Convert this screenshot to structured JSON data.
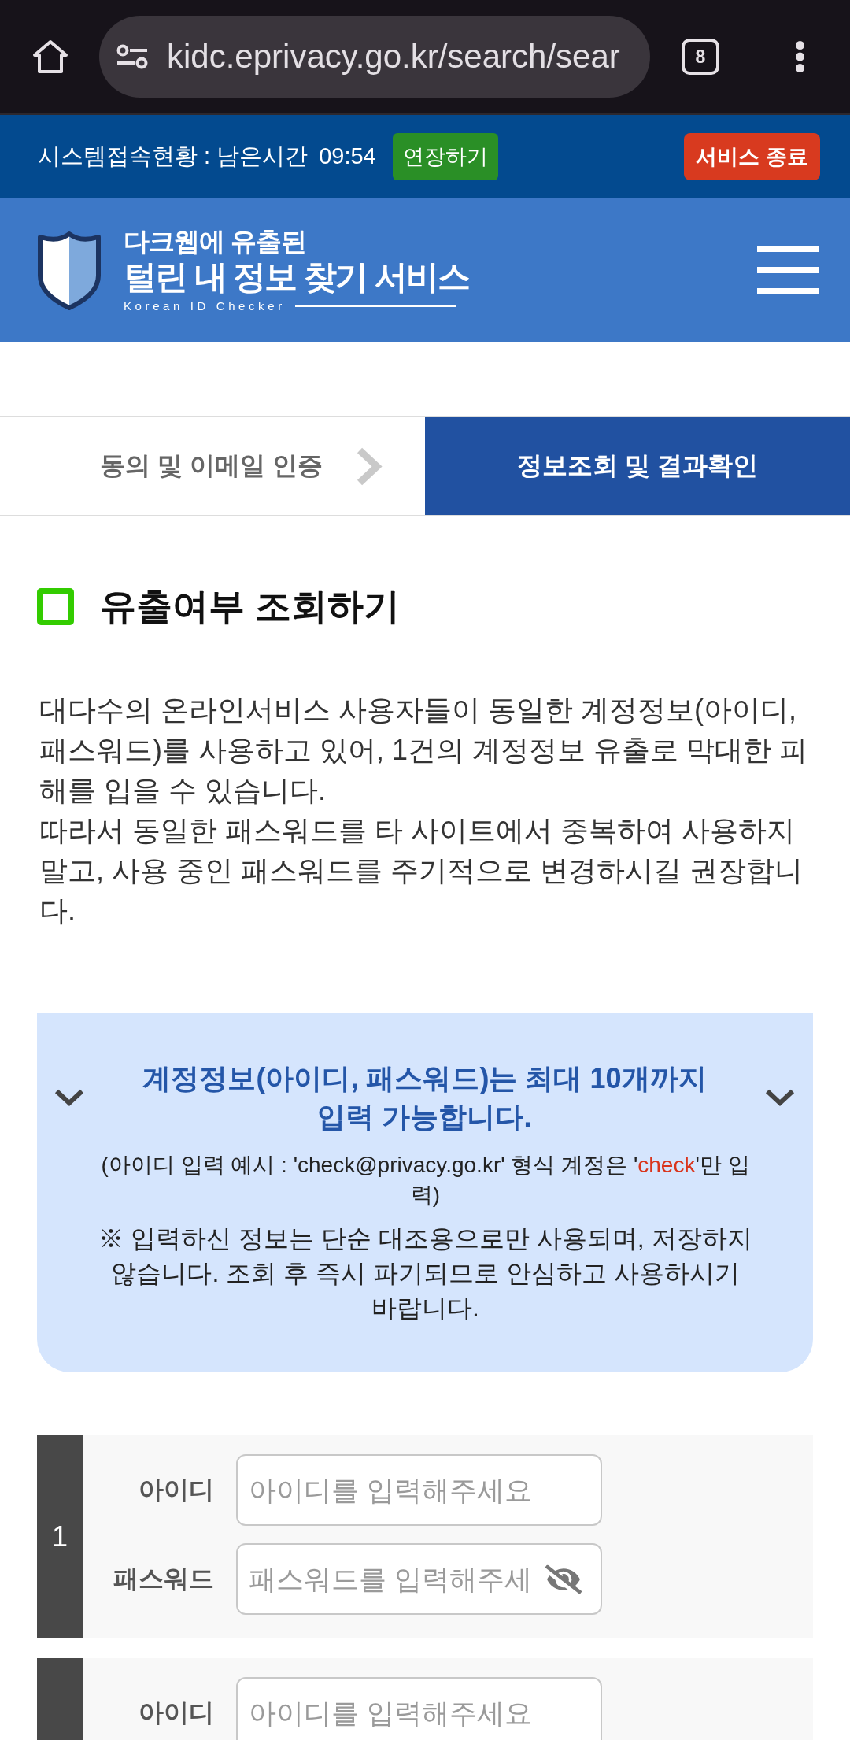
{
  "browser": {
    "url": "kidc.eprivacy.go.kr/search/sear",
    "tab_count": "8"
  },
  "session_bar": {
    "label": "시스템접속현황 : 남은시간",
    "time": "09:54",
    "extend_button": "연장하기",
    "end_button": "서비스 종료"
  },
  "header": {
    "subtitle": "다크웹에 유출된",
    "title": "털린 내 정보 찾기 서비스",
    "tagline": "Korean ID Checker"
  },
  "steps": [
    {
      "label": "동의 및 이메일 인증",
      "selected": false
    },
    {
      "label": "정보조회 및 결과확인",
      "selected": true
    }
  ],
  "section": {
    "title": "유출여부 조회하기",
    "paragraphs": [
      "대다수의 온라인서비스 사용자들이 동일한 계정정보(아이디, 패스워드)를 사용하고 있어, 1건의 계정정보 유출로 막대한 피해를 입을 수 있습니다.",
      "따라서 동일한 패스워드를 타 사이트에서 중복하여 사용하지 말고, 사용 중인 패스워드를 주기적으로 변경하시길 권장합니다."
    ]
  },
  "notice": {
    "title": "계정정보(아이디, 패스워드)는 최대 10개까지 입력 가능합니다.",
    "example": [
      {
        "text": "(아이디 입력 예시 : 'check@privacy.go.kr' 형식 계정은 '",
        "highlight": false
      },
      {
        "text": "check",
        "highlight": true
      },
      {
        "text": "'만 입력)",
        "highlight": false
      }
    ],
    "note": "※ 입력하신 정보는 단순 대조용으로만 사용되며, 저장하지 않습니다. 조회 후 즉시 파기되므로 안심하고 사용하시기 바랍니다."
  },
  "accounts": [
    {
      "number": "1",
      "id_label": "아이디",
      "id_placeholder": "아이디를 입력해주세요",
      "password_label": "패스워드",
      "password_placeholder": "패스워드를 입력해주세",
      "password_visible": false
    },
    {
      "id_label": "아이디",
      "id_placeholder": "아이디를 입력해주세요"
    }
  ]
}
